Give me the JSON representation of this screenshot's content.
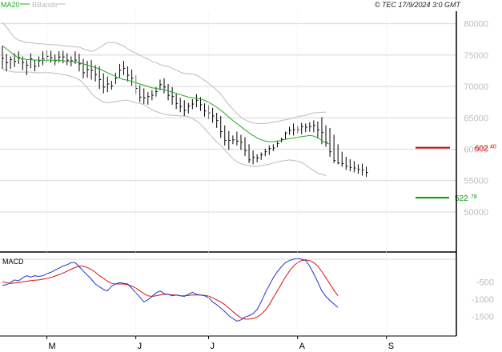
{
  "header": {
    "legend_ma": "MA20",
    "legend_bb": "BBands",
    "copyright": "© TEC 17/9/2024 3:0 GMT"
  },
  "colors": {
    "ma": "#22aa22",
    "bb": "#bbbbbb",
    "bars": "#000000",
    "macd": "#2233cc",
    "signal": "#dd1111",
    "resistance": "#cc0000",
    "support": "#009900",
    "grid": "#d8d8d8"
  },
  "chart_data": [
    {
      "type": "ohlc",
      "title": "",
      "ylim": [
        44000,
        82000
      ],
      "yticks": [
        50000,
        55000,
        60000,
        65000,
        70000,
        75000,
        80000
      ],
      "ytick_labels": [
        "50000",
        "55000",
        "60000",
        "65000",
        "70000",
        "75000",
        "80000"
      ],
      "xlabels": [
        "M",
        "J",
        "J",
        "A",
        "S"
      ],
      "xlabel_positions": [
        11,
        33,
        51,
        73,
        95
      ],
      "grid": true,
      "series_ohlc": {
        "x": [
          0,
          1,
          2,
          3,
          4,
          5,
          6,
          7,
          8,
          9,
          10,
          11,
          12,
          13,
          14,
          15,
          16,
          17,
          18,
          19,
          20,
          21,
          22,
          23,
          24,
          25,
          26,
          27,
          28,
          29,
          30,
          31,
          32,
          33,
          34,
          35,
          36,
          37,
          38,
          39,
          40,
          41,
          42,
          43,
          44,
          45,
          46,
          47,
          48,
          49,
          50,
          51,
          52,
          53,
          54,
          55,
          56,
          57,
          58,
          59,
          60,
          61,
          62,
          63,
          64,
          65,
          66,
          67,
          68,
          69,
          70,
          71,
          72,
          73,
          74,
          75,
          76,
          77,
          78,
          79,
          80,
          81,
          82,
          83,
          84,
          85,
          86,
          87,
          88,
          89,
          90,
          91,
          92,
          93,
          94,
          95,
          96,
          97,
          98,
          99,
          100,
          101
        ],
        "high": [
          76500,
          75200,
          74800,
          75300,
          75600,
          74800,
          74200,
          75300,
          74300,
          74800,
          75600,
          75800,
          75700,
          75100,
          75600,
          75700,
          75300,
          74800,
          75600,
          75200,
          74400,
          74100,
          74200,
          73400,
          73200,
          72100,
          71600,
          70900,
          72200,
          73600,
          74100,
          73200,
          72700,
          71800,
          70200,
          69700,
          69100,
          69400,
          69900,
          71100,
          71300,
          70400,
          69900,
          68900,
          68200,
          67800,
          67400,
          68000,
          68800,
          68300,
          67300,
          67000,
          66600,
          65800,
          65300,
          63800,
          62900,
          62200,
          62800,
          62300,
          61900,
          60800,
          59800,
          59200,
          59500,
          60100,
          60600,
          60800,
          61300,
          61800,
          62800,
          63600,
          64100,
          63700,
          64200,
          64100,
          64300,
          64600,
          64400,
          65100,
          63800,
          63400,
          62300,
          60800,
          59600,
          58800,
          58400,
          58100,
          57600,
          57700,
          57200
        ],
        "low": [
          72800,
          72400,
          72800,
          73100,
          73600,
          72600,
          71800,
          72900,
          72400,
          73100,
          73400,
          73900,
          73800,
          73400,
          73800,
          73700,
          73400,
          73200,
          73600,
          72400,
          71300,
          71400,
          71100,
          70800,
          69600,
          68900,
          69100,
          69500,
          70400,
          71400,
          71800,
          70800,
          70100,
          68800,
          67500,
          67200,
          67100,
          67800,
          68400,
          69400,
          68900,
          67800,
          67100,
          66400,
          65900,
          65300,
          65700,
          66400,
          66700,
          66100,
          65200,
          64800,
          64200,
          63400,
          61800,
          60600,
          59900,
          60800,
          60600,
          59900,
          58900,
          57800,
          57600,
          57900,
          58300,
          58900,
          59100,
          59700,
          60300,
          61100,
          61500,
          62300,
          62200,
          62500,
          62400,
          62700,
          62800,
          62700,
          61800,
          60800,
          60400,
          58800,
          57800,
          57600,
          57200,
          56700,
          56500,
          56300,
          56100,
          55800,
          55600
        ],
        "close": [
          74500,
          73800,
          74300,
          74000,
          74600,
          73800,
          73400,
          74400,
          73200,
          74100,
          74400,
          74800,
          74600,
          74100,
          74700,
          74700,
          74200,
          74100,
          74200,
          73600,
          72200,
          72700,
          72600,
          71900,
          71100,
          69900,
          70400,
          70100,
          71300,
          72600,
          72900,
          71800,
          71300,
          69700,
          68300,
          68200,
          68400,
          68600,
          69200,
          70300,
          69900,
          68600,
          68400,
          67300,
          66800,
          66200,
          66900,
          67200,
          67800,
          67100,
          66100,
          65800,
          65300,
          64600,
          62800,
          61400,
          61400,
          61500,
          61300,
          61100,
          59800,
          58300,
          58700,
          58600,
          59100,
          59600,
          60100,
          60200,
          60900,
          61600,
          62600,
          63000,
          63100,
          63100,
          63600,
          63500,
          63600,
          63800,
          63100,
          62700,
          61100,
          59600,
          58200,
          57800,
          57700,
          57300,
          57100,
          57000,
          56800,
          56700,
          56300
        ]
      },
      "series": [
        {
          "name": "MA20",
          "values": [
            76500,
            76000,
            75500,
            75000,
            74500,
            74400,
            74300,
            74300,
            74200,
            74200,
            74200,
            74200,
            74200,
            74200,
            74200,
            74100,
            74000,
            74000,
            73900,
            73800,
            73600,
            73400,
            73200,
            73000,
            72800,
            72500,
            72200,
            71900,
            71600,
            71300,
            71100,
            71000,
            70800,
            70600,
            70400,
            70200,
            70000,
            69800,
            69700,
            69600,
            69500,
            69300,
            69100,
            68900,
            68700,
            68500,
            68300,
            68200,
            68100,
            68000,
            67800,
            67500,
            67100,
            66700,
            66200,
            65700,
            65100,
            64600,
            64100,
            63600,
            63100,
            62600,
            62200,
            61800,
            61500,
            61300,
            61200,
            61200,
            61300,
            61400,
            61600,
            61700,
            61800,
            61900,
            62000,
            62100,
            62200,
            62100,
            61800,
            61400,
            61000,
            60800
          ]
        },
        {
          "name": "BBands upper",
          "values": [
            80200,
            79500,
            78600,
            77800,
            77400,
            77200,
            77000,
            77000,
            76900,
            76800,
            76800,
            76700,
            76700,
            76600,
            76600,
            76500,
            76400,
            76400,
            76300,
            76300,
            76000,
            75800,
            75600,
            75800,
            76200,
            76600,
            77000,
            77000,
            77000,
            76700,
            76500,
            76000,
            75600,
            75300,
            75000,
            74600,
            74400,
            74000,
            73800,
            73500,
            73300,
            73200,
            72900,
            72600,
            72300,
            72100,
            72000,
            72000,
            71800,
            71400,
            71000,
            70500,
            70000,
            69400,
            68800,
            67900,
            67100,
            66400,
            65700,
            65100,
            64700,
            64400,
            64200,
            64100,
            64100,
            64100,
            64200,
            64300,
            64400,
            64600,
            64700,
            64800,
            65000,
            65200,
            65300,
            65400,
            65600,
            65800,
            65800,
            65900,
            65900
          ]
        },
        {
          "name": "BBands lower",
          "values": [
            72800,
            72600,
            72400,
            72300,
            72300,
            72300,
            72300,
            72300,
            72200,
            72200,
            72200,
            72200,
            72200,
            72100,
            72000,
            71900,
            71800,
            71600,
            71400,
            71100,
            70500,
            69800,
            68900,
            68300,
            67900,
            67500,
            67400,
            67500,
            67600,
            67700,
            67800,
            67800,
            67600,
            67400,
            67300,
            67100,
            66700,
            66300,
            66000,
            65800,
            65600,
            65500,
            65400,
            65400,
            65300,
            65300,
            65200,
            64900,
            64500,
            64000,
            63300,
            62600,
            61800,
            61200,
            60600,
            59900,
            59200,
            58500,
            58000,
            57700,
            57500,
            57400,
            57300,
            57300,
            57400,
            57500,
            57600,
            57800,
            58000,
            58100,
            58200,
            58300,
            58200,
            58100,
            57900,
            57500,
            57000,
            56600,
            56200,
            56000,
            55800
          ]
        }
      ],
      "annotations": [
        {
          "label": "602",
          "sup": "40",
          "value": 60240,
          "color": "#cc0000"
        },
        {
          "label": "522",
          "sup": "78",
          "value": 52278,
          "color": "#009900"
        }
      ]
    },
    {
      "type": "line",
      "title": "MACD",
      "ylim": [
        -2000,
        300
      ],
      "yticks": [
        -500,
        -1000,
        -1500
      ],
      "ytick_labels": [
        "-500",
        "-1000",
        "-1500"
      ],
      "grid": true,
      "series": [
        {
          "name": "MACD",
          "values": [
            -600,
            -580,
            -520,
            -440,
            -470,
            -380,
            -320,
            -360,
            -320,
            -340,
            -320,
            -260,
            -220,
            -160,
            -100,
            -40,
            0,
            60,
            60,
            -60,
            -180,
            -300,
            -420,
            -560,
            -640,
            -720,
            -760,
            -620,
            -560,
            -520,
            -540,
            -560,
            -680,
            -820,
            -940,
            -1080,
            -1020,
            -920,
            -820,
            -760,
            -840,
            -860,
            -900,
            -880,
            -900,
            -920,
            -860,
            -800,
            -860,
            -880,
            -900,
            -960,
            -1080,
            -1160,
            -1260,
            -1360,
            -1480,
            -1560,
            -1640,
            -1600,
            -1520,
            -1480,
            -1420,
            -1300,
            -1080,
            -820,
            -600,
            -380,
            -200,
            -60,
            60,
            120,
            160,
            180,
            160,
            120,
            -40,
            -260,
            -500,
            -760,
            -920,
            -1040,
            -1140,
            -1240
          ]
        },
        {
          "name": "Signal",
          "values": [
            -500,
            -520,
            -540,
            -530,
            -520,
            -500,
            -480,
            -460,
            -450,
            -440,
            -420,
            -400,
            -370,
            -330,
            -290,
            -240,
            -190,
            -130,
            -80,
            -40,
            -40,
            -80,
            -140,
            -220,
            -320,
            -400,
            -480,
            -540,
            -560,
            -560,
            -560,
            -580,
            -620,
            -680,
            -760,
            -840,
            -900,
            -920,
            -900,
            -880,
            -860,
            -860,
            -880,
            -880,
            -900,
            -900,
            -890,
            -880,
            -880,
            -880,
            -890,
            -910,
            -960,
            -1020,
            -1080,
            -1160,
            -1260,
            -1360,
            -1460,
            -1540,
            -1580,
            -1580,
            -1560,
            -1520,
            -1440,
            -1320,
            -1160,
            -960,
            -760,
            -560,
            -360,
            -180,
            -40,
            60,
            120,
            140,
            120,
            60,
            -40,
            -200,
            -380,
            -560,
            -740,
            -900
          ]
        }
      ]
    }
  ]
}
